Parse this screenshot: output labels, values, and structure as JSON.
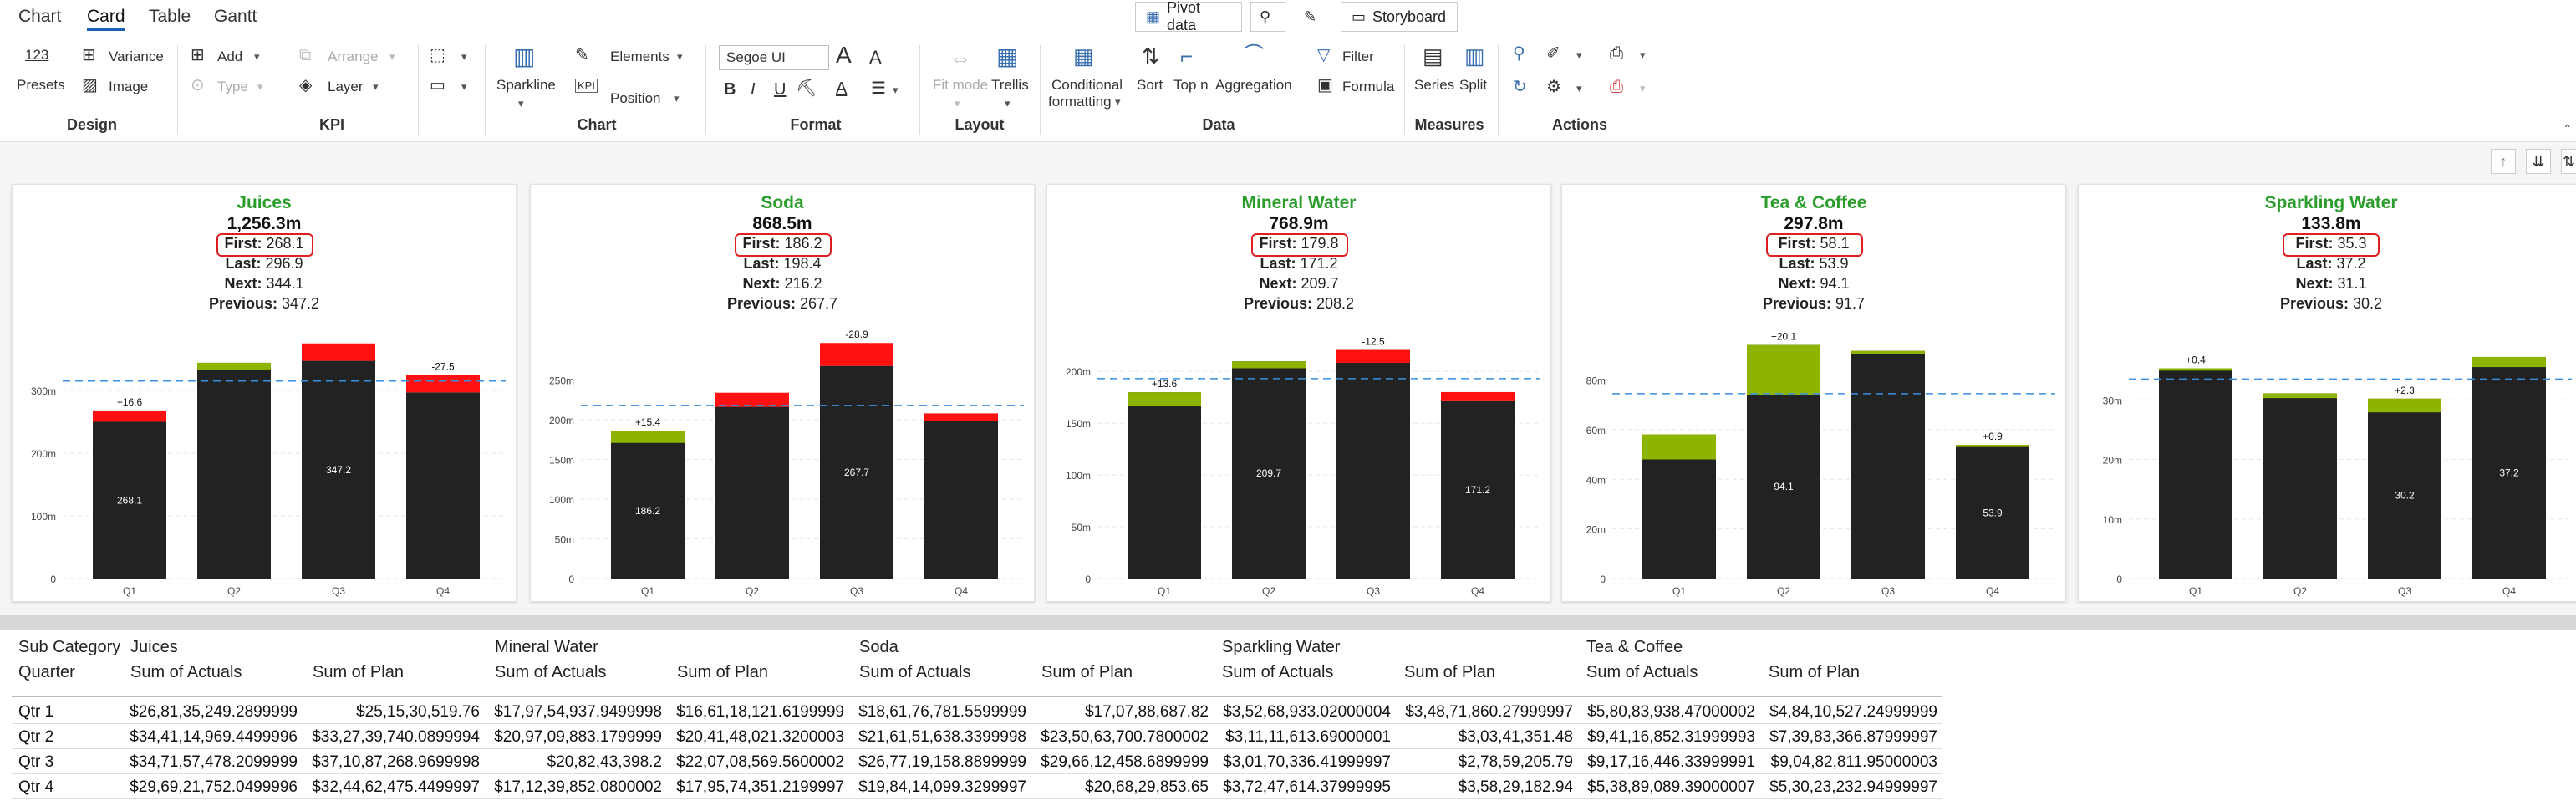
{
  "tabs": [
    "Chart",
    "Card",
    "Table",
    "Gantt"
  ],
  "top_buttons": {
    "pivot": "Pivot data",
    "storyboard": "Storyboard"
  },
  "ribbon": {
    "presets_num": "123",
    "presets": "Presets",
    "variance": "Variance",
    "image": "Image",
    "add": "Add",
    "type": "Type",
    "arrange": "Arrange",
    "layer": "Layer",
    "sparkline": "Sparkline",
    "elements": "Elements",
    "position": "Position",
    "font": "Segoe UI",
    "font_grow": "A",
    "font_shrink": "A",
    "bold": "B",
    "italic": "I",
    "underline": "U",
    "fit_mode": "Fit mode",
    "trellis": "Trellis",
    "conditional": "Conditional",
    "formatting": "formatting",
    "sort": "Sort",
    "topn": "Top n",
    "aggregation": "Aggregation",
    "filter": "Filter",
    "formula": "Formula",
    "series": "Series",
    "split": "Split",
    "groups": {
      "design": "Design",
      "kpi": "KPI",
      "chart": "Chart",
      "format": "Format",
      "layout": "Layout",
      "data": "Data",
      "measures": "Measures",
      "actions": "Actions"
    }
  },
  "card_labels": {
    "first": "First:",
    "last": "Last:",
    "next": "Next:",
    "previous": "Previous:"
  },
  "cards": [
    {
      "title": "Juices",
      "total": "1,256.3m",
      "first": "268.1",
      "last": "296.9",
      "next": "344.1",
      "previous": "347.2"
    },
    {
      "title": "Soda",
      "total": "868.5m",
      "first": "186.2",
      "last": "198.4",
      "next": "216.2",
      "previous": "267.7"
    },
    {
      "title": "Mineral Water",
      "total": "768.9m",
      "first": "179.8",
      "last": "171.2",
      "next": "209.7",
      "previous": "208.2"
    },
    {
      "title": "Tea & Coffee",
      "total": "297.8m",
      "first": "58.1",
      "last": "53.9",
      "next": "94.1",
      "previous": "91.7"
    },
    {
      "title": "Sparkling Water",
      "total": "133.8m",
      "first": "35.3",
      "last": "37.2",
      "next": "31.1",
      "previous": "30.2"
    }
  ],
  "colors": {
    "title": "#2a9d2a",
    "bar": "#222222",
    "positive": "#8db500",
    "negative": "#ff1111",
    "average": "#3a8fe0"
  },
  "chart_data": [
    {
      "type": "bar",
      "title": "Juices",
      "categories": [
        "Q1",
        "Q2",
        "Q3",
        "Q4"
      ],
      "ylim": [
        0,
        380
      ],
      "yticks": [
        0,
        100,
        200,
        300
      ],
      "ytick_labels": [
        "0",
        "100m",
        "200m",
        "300m"
      ],
      "average": 315,
      "bars": [
        {
          "base": 250,
          "top": 268.1,
          "delta": "+16.6",
          "label": "268.1"
        },
        {
          "base": 344.1,
          "top": 332,
          "delta": "",
          "label": ""
        },
        {
          "base": 347.2,
          "top": 375,
          "delta": "",
          "label": "347.2"
        },
        {
          "base": 296.9,
          "top": 324.4,
          "delta": "-27.5",
          "label": ""
        }
      ]
    },
    {
      "type": "bar",
      "title": "Soda",
      "categories": [
        "Q1",
        "Q2",
        "Q3",
        "Q4"
      ],
      "ylim": [
        0,
        300
      ],
      "yticks": [
        0,
        50,
        100,
        150,
        200,
        250
      ],
      "ytick_labels": [
        "0",
        "50m",
        "100m",
        "150m",
        "200m",
        "250m"
      ],
      "average": 218,
      "bars": [
        {
          "base": 186.2,
          "top": 170.8,
          "delta": "+15.4",
          "label": "186.2"
        },
        {
          "base": 216.2,
          "top": 234,
          "delta": "",
          "label": ""
        },
        {
          "base": 267.7,
          "top": 296.6,
          "delta": "-28.9",
          "label": "267.7"
        },
        {
          "base": 198.4,
          "top": 208,
          "delta": "",
          "label": ""
        }
      ]
    },
    {
      "type": "bar",
      "title": "Mineral Water",
      "categories": [
        "Q1",
        "Q2",
        "Q3",
        "Q4"
      ],
      "ylim": [
        0,
        230
      ],
      "yticks": [
        0,
        50,
        100,
        150,
        200
      ],
      "ytick_labels": [
        "0",
        "50m",
        "100m",
        "150m",
        "200m"
      ],
      "average": 193,
      "bars": [
        {
          "base": 179.8,
          "top": 166.2,
          "delta": "+13.6",
          "label": ""
        },
        {
          "base": 209.7,
          "top": 203,
          "delta": "",
          "label": "209.7"
        },
        {
          "base": 208.2,
          "top": 220.7,
          "delta": "-12.5",
          "label": ""
        },
        {
          "base": 171.2,
          "top": 180,
          "delta": "",
          "label": "171.2"
        }
      ]
    },
    {
      "type": "bar",
      "title": "Tea & Coffee",
      "categories": [
        "Q1",
        "Q2",
        "Q3",
        "Q4"
      ],
      "ylim": [
        0,
        96
      ],
      "yticks": [
        0,
        20,
        40,
        60,
        80
      ],
      "ytick_labels": [
        "0",
        "20m",
        "40m",
        "60m",
        "80m"
      ],
      "average": 74.5,
      "bars": [
        {
          "base": 58.1,
          "top": 48,
          "delta": "",
          "label": ""
        },
        {
          "base": 94.1,
          "top": 74,
          "delta": "+20.1",
          "label": "94.1"
        },
        {
          "base": 91.7,
          "top": 90.5,
          "delta": "",
          "label": ""
        },
        {
          "base": 53.9,
          "top": 53,
          "delta": "+0.9",
          "label": "53.9"
        }
      ]
    },
    {
      "type": "bar",
      "title": "Sparkling Water",
      "categories": [
        "Q1",
        "Q2",
        "Q3",
        "Q4"
      ],
      "ylim": [
        0,
        40
      ],
      "yticks": [
        0,
        10,
        20,
        30
      ],
      "ytick_labels": [
        "0",
        "10m",
        "20m",
        "30m"
      ],
      "average": 33.5,
      "bars": [
        {
          "base": 35.3,
          "top": 34.9,
          "delta": "+0.4",
          "label": ""
        },
        {
          "base": 31.1,
          "top": 30.3,
          "delta": "",
          "label": ""
        },
        {
          "base": 30.2,
          "top": 27.9,
          "delta": "+2.3",
          "label": "30.2"
        },
        {
          "base": 37.2,
          "top": 35.5,
          "delta": "",
          "label": "37.2"
        }
      ]
    }
  ],
  "table": {
    "header_row1": [
      "Sub Category",
      "Juices",
      "",
      "Mineral Water",
      "",
      "Soda",
      "",
      "Sparkling Water",
      "",
      "Tea & Coffee",
      ""
    ],
    "header_row2": [
      "Quarter",
      "Sum of Actuals",
      "Sum of Plan",
      "Sum of Actuals",
      "Sum of Plan",
      "Sum of Actuals",
      "Sum of Plan",
      "Sum of Actuals",
      "Sum of Plan",
      "Sum of Actuals",
      "Sum of Plan"
    ],
    "rows": [
      [
        "Qtr 1",
        "$26,81,35,249.2899999",
        "$25,15,30,519.76",
        "$17,97,54,937.9499998",
        "$16,61,18,121.6199999",
        "$18,61,76,781.5599999",
        "$17,07,88,687.82",
        "$3,52,68,933.02000004",
        "$3,48,71,860.27999997",
        "$5,80,83,938.47000002",
        "$4,84,10,527.24999999"
      ],
      [
        "Qtr 2",
        "$34,41,14,969.4499996",
        "$33,27,39,740.0899994",
        "$20,97,09,883.1799999",
        "$20,41,48,021.3200003",
        "$21,61,51,638.3399998",
        "$23,50,63,700.7800002",
        "$3,11,11,613.69000001",
        "$3,03,41,351.48",
        "$9,41,16,852.31999993",
        "$7,39,83,366.87999997"
      ],
      [
        "Qtr 3",
        "$34,71,57,478.2099999",
        "$37,10,87,268.9699998",
        "$20,82,43,398.2",
        "$22,07,08,569.5600002",
        "$26,77,19,158.8899999",
        "$29,66,12,458.6899999",
        "$3,01,70,336.41999997",
        "$2,78,59,205.79",
        "$9,17,16,446.33999991",
        "$9,04,82,811.95000003"
      ],
      [
        "Qtr 4",
        "$29,69,21,752.0499996",
        "$32,44,62,475.4499997",
        "$17,12,39,852.0800002",
        "$17,95,74,351.2199997",
        "$19,84,14,099.3299997",
        "$20,68,29,853.65",
        "$3,72,47,614.37999995",
        "$3,58,29,182.94",
        "$5,38,89,089.39000007",
        "$5,30,23,232.94999997"
      ]
    ]
  }
}
